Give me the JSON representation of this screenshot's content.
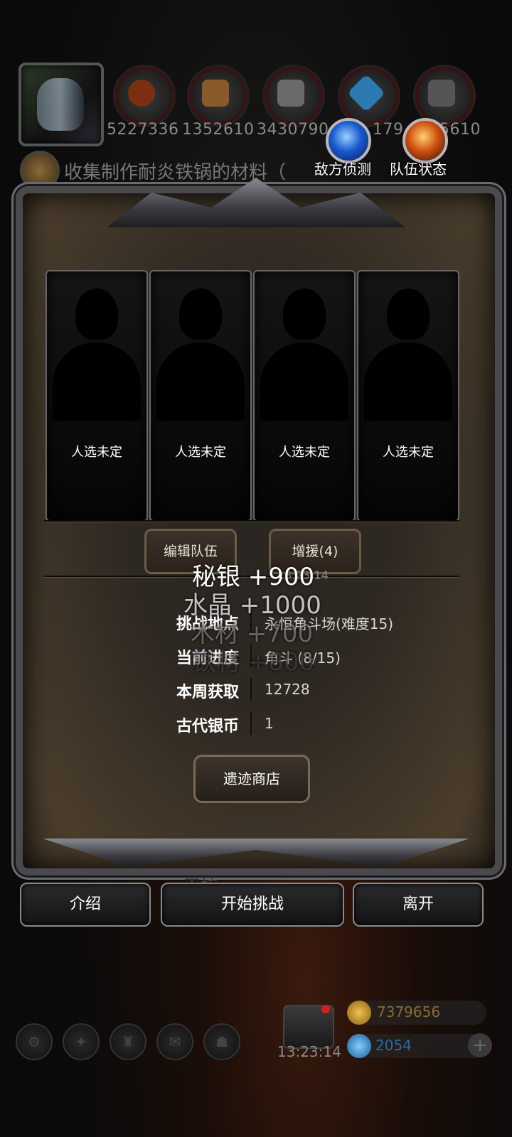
{
  "resources": [
    {
      "icon": "meat-icon",
      "value": "5227336",
      "color": "#7a3010"
    },
    {
      "icon": "wood-icon",
      "value": "1352610",
      "color": "#8a5a2a"
    },
    {
      "icon": "iron-icon",
      "value": "3430790",
      "color": "#6a6a6a"
    },
    {
      "icon": "crystal-icon",
      "value": "179",
      "color": "#2a7ab0"
    },
    {
      "icon": "metal-icon",
      "value": "5610",
      "color": "#555555"
    }
  ],
  "quest": {
    "text": "收集制作耐炎铁锅的材料（"
  },
  "top_buttons": {
    "scout_label": "敌方侦测",
    "team_status_label": "队伍状态"
  },
  "slots": [
    {
      "label": "人选未定"
    },
    {
      "label": "人选未定"
    },
    {
      "label": "人选未定"
    },
    {
      "label": "人选未定"
    }
  ],
  "panel_buttons": {
    "edit_team": "编辑队伍",
    "reinforce": "增援(4)",
    "shop": "遗迹商店"
  },
  "rewards": [
    {
      "text": "秘银 +900"
    },
    {
      "text": "水晶 +1000"
    },
    {
      "text": "木材 +700"
    },
    {
      "text": "铁材 +800"
    }
  ],
  "faded_time": "13:23:14",
  "info": [
    {
      "label": "挑战地点",
      "value": "永恒角斗场(难度15)"
    },
    {
      "label": "当前进度",
      "value": "角斗 (8/15)"
    },
    {
      "label": "本周获取",
      "value": "12728"
    },
    {
      "label": "古代银币",
      "value": "1"
    }
  ],
  "bottom_buttons": {
    "intro": "介绍",
    "start": "开始挑战",
    "leave": "离开"
  },
  "background_text": "工坊",
  "clock": "13:23:14",
  "currencies": [
    {
      "icon": "gold-scroll-icon",
      "value": "7379656",
      "color": "#c9a233"
    },
    {
      "icon": "gem-icon",
      "value": "2054",
      "color": "#2a8ad0"
    }
  ]
}
